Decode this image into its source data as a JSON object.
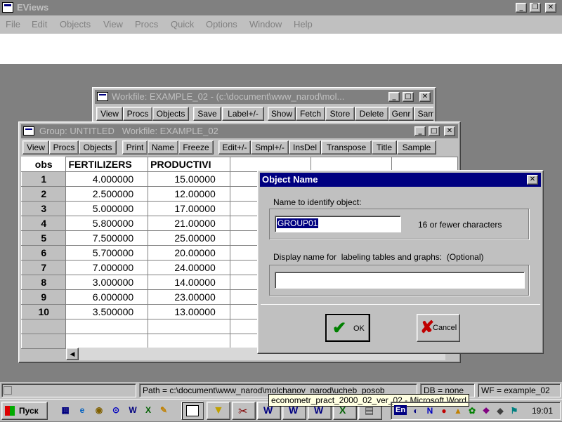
{
  "app": {
    "title": "EViews",
    "menu": [
      "File",
      "Edit",
      "Objects",
      "View",
      "Procs",
      "Quick",
      "Options",
      "Window",
      "Help"
    ]
  },
  "workfile_window": {
    "title": "Workfile: EXAMPLE_02 - (c:\\document\\www_narod\\mol...",
    "toolbar": [
      "View",
      "Procs",
      "Objects",
      "Save",
      "Label+/-",
      "Show",
      "Fetch",
      "Store",
      "Delete",
      "Genr",
      "Sam"
    ]
  },
  "group_window": {
    "title": "Group: UNTITLED   Workfile: EXAMPLE_02",
    "toolbar": [
      "View",
      "Procs",
      "Objects",
      "Print",
      "Name",
      "Freeze",
      "Edit+/-",
      "Smpl+/-",
      "InsDel",
      "Transpose",
      "Title",
      "Sample"
    ],
    "columns": [
      "obs",
      "FERTILIZERS",
      "PRODUCTIVI"
    ],
    "rows": [
      [
        "1",
        "4.000000",
        "15.00000"
      ],
      [
        "2",
        "2.500000",
        "12.00000"
      ],
      [
        "3",
        "5.000000",
        "17.00000"
      ],
      [
        "4",
        "5.800000",
        "21.00000"
      ],
      [
        "5",
        "7.500000",
        "25.00000"
      ],
      [
        "6",
        "5.700000",
        "20.00000"
      ],
      [
        "7",
        "7.000000",
        "24.00000"
      ],
      [
        "8",
        "3.000000",
        "14.00000"
      ],
      [
        "9",
        "6.000000",
        "23.00000"
      ],
      [
        "10",
        "3.500000",
        "13.00000"
      ]
    ]
  },
  "dialog": {
    "title": "Object Name",
    "name_label": "Name to identify object:",
    "name_value": "GROUP01",
    "name_hint": "16 or fewer characters",
    "display_label": "Display name for  labeling tables and graphs:  (Optional)",
    "display_value": "",
    "ok_label": "OK",
    "cancel_label": "Cancel"
  },
  "status": {
    "path": "Path = c:\\document\\www_narod\\molchanov_narod\\ucheb_posob",
    "db": "DB = none",
    "wf": "WF = example_02"
  },
  "taskbar": {
    "start_label": "Пуск",
    "tooltip": "econometr_pract_2000_02_ver_02 - Microsoft Word",
    "lang": "En",
    "clock": "19:01"
  }
}
